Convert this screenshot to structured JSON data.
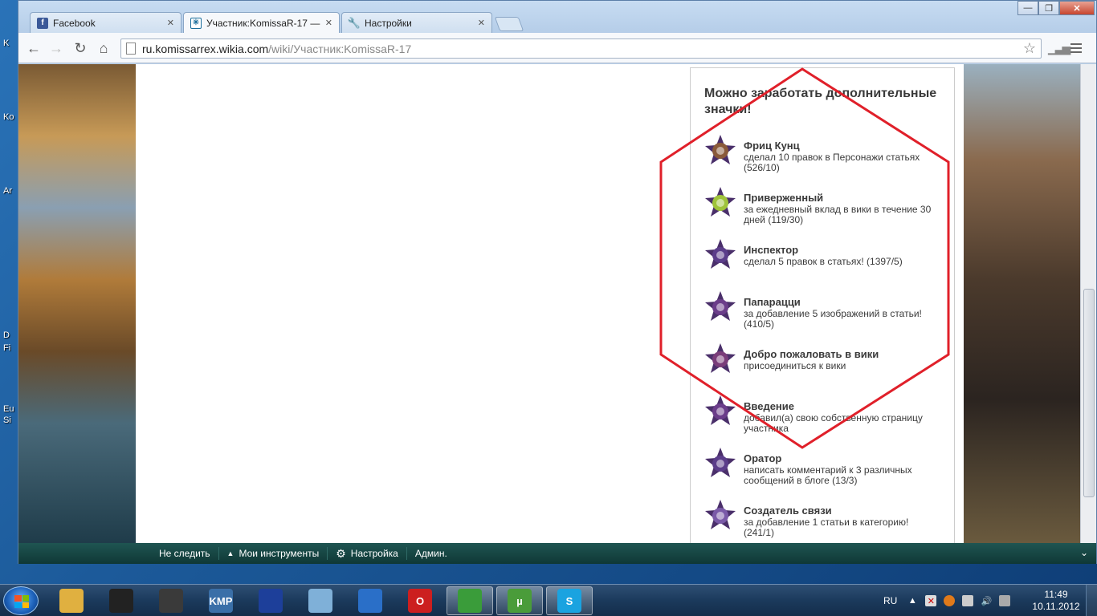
{
  "browser": {
    "tabs": [
      {
        "label": "Facebook",
        "favicon": "facebook-icon",
        "color": "#3b5998"
      },
      {
        "label": "Участник:KomissaR-17 —",
        "favicon": "wikia-icon",
        "color": "#1b6e9c"
      },
      {
        "label": "Настройки",
        "favicon": "wrench-icon",
        "color": "#666666"
      }
    ],
    "url_host": "ru.komissarrex.wikia.com",
    "url_path": "/wiki/Участник:KomissaR-17"
  },
  "desktop_labels": [
    "K",
    "Ko",
    "Ar",
    "D",
    "Fi",
    "Eu",
    "Si"
  ],
  "rail": {
    "title": "Можно заработать дополнительные значки!",
    "badges": [
      {
        "name": "Фриц Кунц",
        "desc": "сделал 10 правок в Персонажи статьях (526/10)",
        "icon": "portrait-star-icon",
        "color": "#8a5a3a"
      },
      {
        "name": "Приверженный",
        "desc": "за ежедневный вклад в вики в течение 30 дней (119/30)",
        "icon": "calendar-badge-icon",
        "color": "#9fc33a"
      },
      {
        "name": "Инспектор",
        "desc": "сделал 5 правок в статьях! (1397/5)",
        "icon": "inspector-star-icon",
        "color": "#5b3d8a"
      },
      {
        "name": "Папарацци",
        "desc": "за добавление 5 изображений в статьи! (410/5)",
        "icon": "camera-star-icon",
        "color": "#6b3d8a"
      },
      {
        "name": "Добро пожаловать в вики",
        "desc": "присоединиться к вики",
        "icon": "welcome-star-icon",
        "color": "#7a3d7a"
      },
      {
        "name": "Введение",
        "desc": "добавил(а) свою собственную страницу участника",
        "icon": "intro-star-icon",
        "color": "#6b3d8a"
      },
      {
        "name": "Оратор",
        "desc": "написать комментарий к 3 различных сообщений в блоге (13/3)",
        "icon": "speaker-star-icon",
        "color": "#5b3d8a"
      },
      {
        "name": "Создатель связи",
        "desc": "за добавление 1 статьи в категорию! (241/1)",
        "icon": "link-star-icon",
        "color": "#7a5aa8"
      }
    ]
  },
  "wikia_toolbar": {
    "unfollow": "Не следить",
    "my_tools": "Мои инструменты",
    "settings": "Настройка",
    "admin": "Админ."
  },
  "taskbar": {
    "apps": [
      {
        "name": "explorer-icon",
        "color": "#e0b040",
        "label": ""
      },
      {
        "name": "mafia-game-icon",
        "color": "#222222",
        "label": ""
      },
      {
        "name": "assassins-creed-icon",
        "color": "#3a3a3a",
        "label": ""
      },
      {
        "name": "kmplayer-icon",
        "color": "#3a6fa8",
        "label": "KMP"
      },
      {
        "name": "floppy-save-icon",
        "color": "#1d3f9a",
        "label": ""
      },
      {
        "name": "notepad-icon",
        "color": "#7fb0d8",
        "label": ""
      },
      {
        "name": "lightning-icon",
        "color": "#2a6fc8",
        "label": ""
      },
      {
        "name": "opera-icon",
        "color": "#cc1f1f",
        "label": "O"
      },
      {
        "name": "chrome-icon",
        "color": "#3a9c3a",
        "label": ""
      },
      {
        "name": "utorrent-icon",
        "color": "#4a9c3a",
        "label": "µ"
      },
      {
        "name": "skype-icon",
        "color": "#1aa3e0",
        "label": "S"
      }
    ],
    "language": "RU",
    "time": "11:49",
    "date": "10.11.2012"
  },
  "annotation_color": "#e0202a"
}
